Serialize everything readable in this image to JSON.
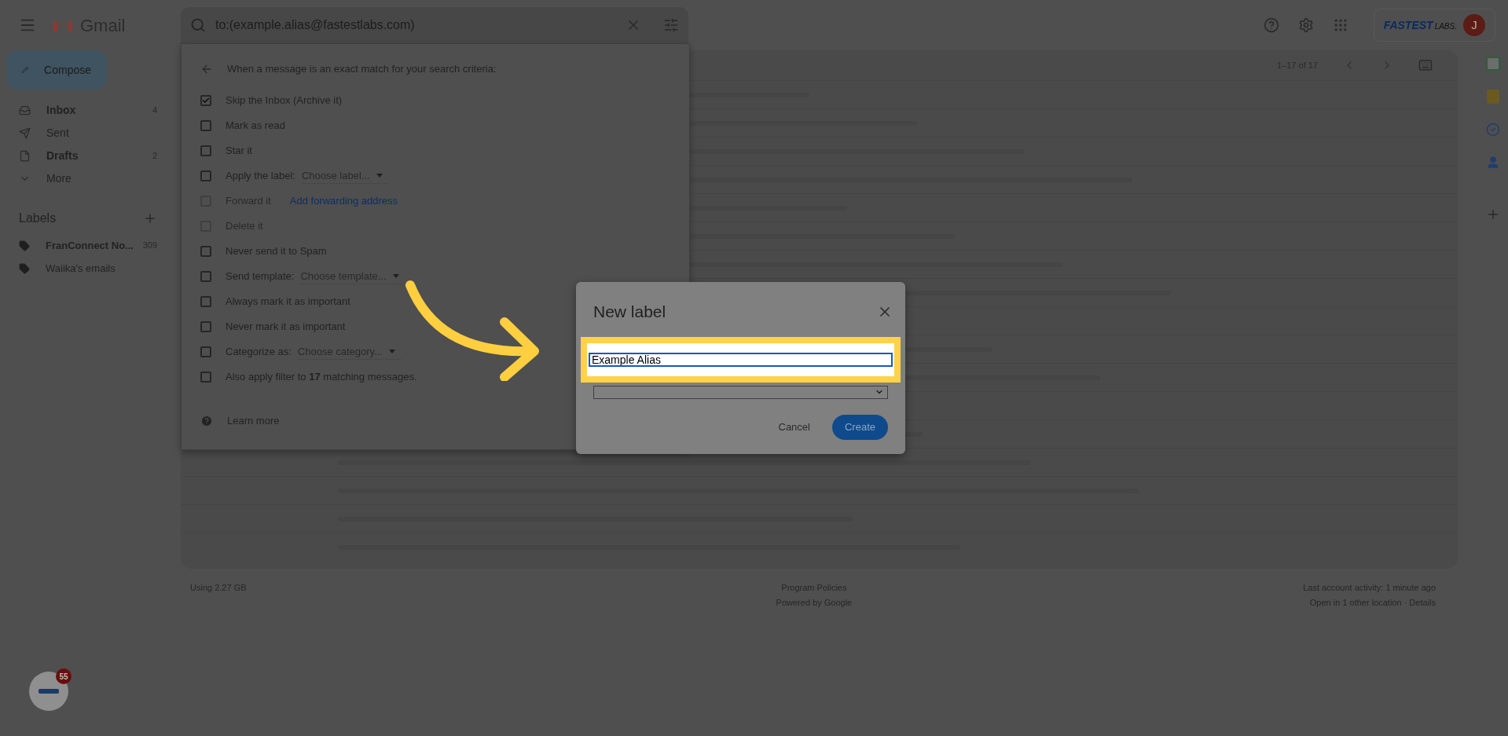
{
  "app": {
    "name": "Gmail"
  },
  "search": {
    "value": "to:(example.alias@fastestlabs.com)"
  },
  "account": {
    "logo_text": "FASTEST",
    "logo_suffix": "LABS.",
    "avatar_letter": "J"
  },
  "compose": "Compose",
  "nav": [
    {
      "kind": "inbox",
      "label": "Inbox",
      "count": "4",
      "bold": true
    },
    {
      "kind": "sent",
      "label": "Sent",
      "bold": false
    },
    {
      "kind": "drafts",
      "label": "Drafts",
      "count": "2",
      "bold": true
    },
    {
      "kind": "more",
      "label": "More",
      "bold": false
    }
  ],
  "labels_heading": "Labels",
  "labels": [
    {
      "name": "FranConnect No...",
      "count": "309",
      "bold": true
    },
    {
      "name": "Waiika's emails",
      "bold": false
    }
  ],
  "filter": {
    "heading": "When a message is an exact match for your search criteria:",
    "options": [
      {
        "kind": "plain",
        "label": "Skip the Inbox (Archive it)",
        "checked": true,
        "disabled": false
      },
      {
        "kind": "plain",
        "label": "Mark as read",
        "checked": false,
        "disabled": false
      },
      {
        "kind": "plain",
        "label": "Star it",
        "checked": false,
        "disabled": false
      },
      {
        "kind": "select",
        "label": "Apply the label:",
        "select": "Choose label...",
        "checked": false,
        "disabled": false
      },
      {
        "kind": "link",
        "label": "Forward it",
        "link": "Add forwarding address",
        "checked": false,
        "disabled": true
      },
      {
        "kind": "plain",
        "label": "Delete it",
        "checked": false,
        "disabled": true
      },
      {
        "kind": "plain",
        "label": "Never send it to Spam",
        "checked": false,
        "disabled": false
      },
      {
        "kind": "select",
        "label": "Send template:",
        "select": "Choose template...",
        "checked": false,
        "disabled": false
      },
      {
        "kind": "plain",
        "label": "Always mark it as important",
        "checked": false,
        "disabled": false
      },
      {
        "kind": "plain",
        "label": "Never mark it as important",
        "checked": false,
        "disabled": false
      },
      {
        "kind": "select",
        "label": "Categorize as:",
        "select": "Choose category...",
        "checked": false,
        "disabled": false
      },
      {
        "kind": "plain",
        "label": "Also apply filter to **17** matching messages.",
        "checked": false,
        "disabled": false
      }
    ],
    "learn_more": "Learn more"
  },
  "list": {
    "range": "1–17 of 17"
  },
  "footer": {
    "storage": "Using 2.27 GB",
    "center": [
      "Program Policies",
      "Powered by Google"
    ],
    "activity": "Last account activity: 1 minute ago",
    "other": "Open in 1 other location · Details"
  },
  "dialog": {
    "title": "New label",
    "value": "Example Alias",
    "cancel": "Cancel",
    "create": "Create"
  },
  "floating_badge": {
    "count": "55"
  }
}
